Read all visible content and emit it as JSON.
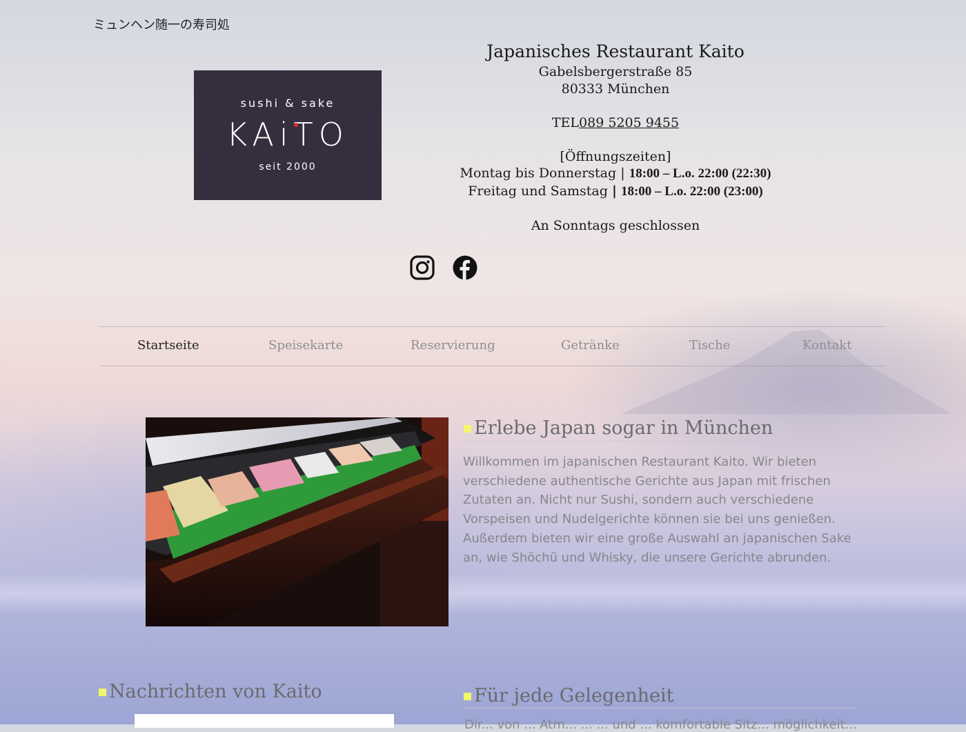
{
  "header": {
    "tagline": "ミュンヘン随一の寿司処"
  },
  "logo": {
    "line1": "sushi & sake",
    "name": "KAiTO",
    "since": "seit 2000",
    "accent_color": "#d92b2b",
    "background": "#352e3e"
  },
  "info": {
    "name": "Japanisches Restaurant Kaito",
    "street": "Gabelsbergerstraße 85",
    "city": "80333 München",
    "tel_label": "TEL",
    "tel_number": "089 5205 9455",
    "hours_title": "[Öffnungszeiten]",
    "hours": [
      {
        "days": "Montag bis Donnerstag",
        "sep": "|",
        "time": "18:00 – L.o. 22:00 (22:30)"
      },
      {
        "days": "Freitag und Samstag",
        "sep": "|",
        "time": "18:00 – L.o. 22:00 (23:00)"
      }
    ],
    "closed": "An Sonntags geschlossen"
  },
  "social": {
    "icons": [
      "instagram-icon",
      "facebook-icon"
    ]
  },
  "nav": {
    "items": [
      {
        "label": "Startseite",
        "active": true
      },
      {
        "label": "Speisekarte",
        "active": false
      },
      {
        "label": "Reservierung",
        "active": false
      },
      {
        "label": "Getränke",
        "active": false
      },
      {
        "label": "Tische",
        "active": false
      },
      {
        "label": "Kontakt",
        "active": false
      }
    ]
  },
  "intro": {
    "heading": "Erlebe Japan sogar in München",
    "text": "Willkommen im japanischen Restaurant Kaito. Wir bieten verschiedene authentische Gerichte aus Japan mit frischen Zutaten an. Nicht nur Sushi, sondern auch verschiedene Vorspeisen und Nudelgerichte können sie bei uns genießen. Außerdem bieten wir eine große Auswahl an japanischen Sake an, wie Shōchū und Whisky, die unsere Gerichte abrunden."
  },
  "news": {
    "heading": "Nachrichten von Kaito"
  },
  "occasion": {
    "heading": "Für jede Gelegenheit",
    "text_start": "Dir... von ... Atm... ... ... und ... komfortable Sitz... möglichkeit..."
  },
  "colors": {
    "heading_marker": "#f2f86a",
    "heading_text": "#6a6a6e",
    "nav_inactive": "#8e8e92",
    "nav_active": "#222222"
  }
}
